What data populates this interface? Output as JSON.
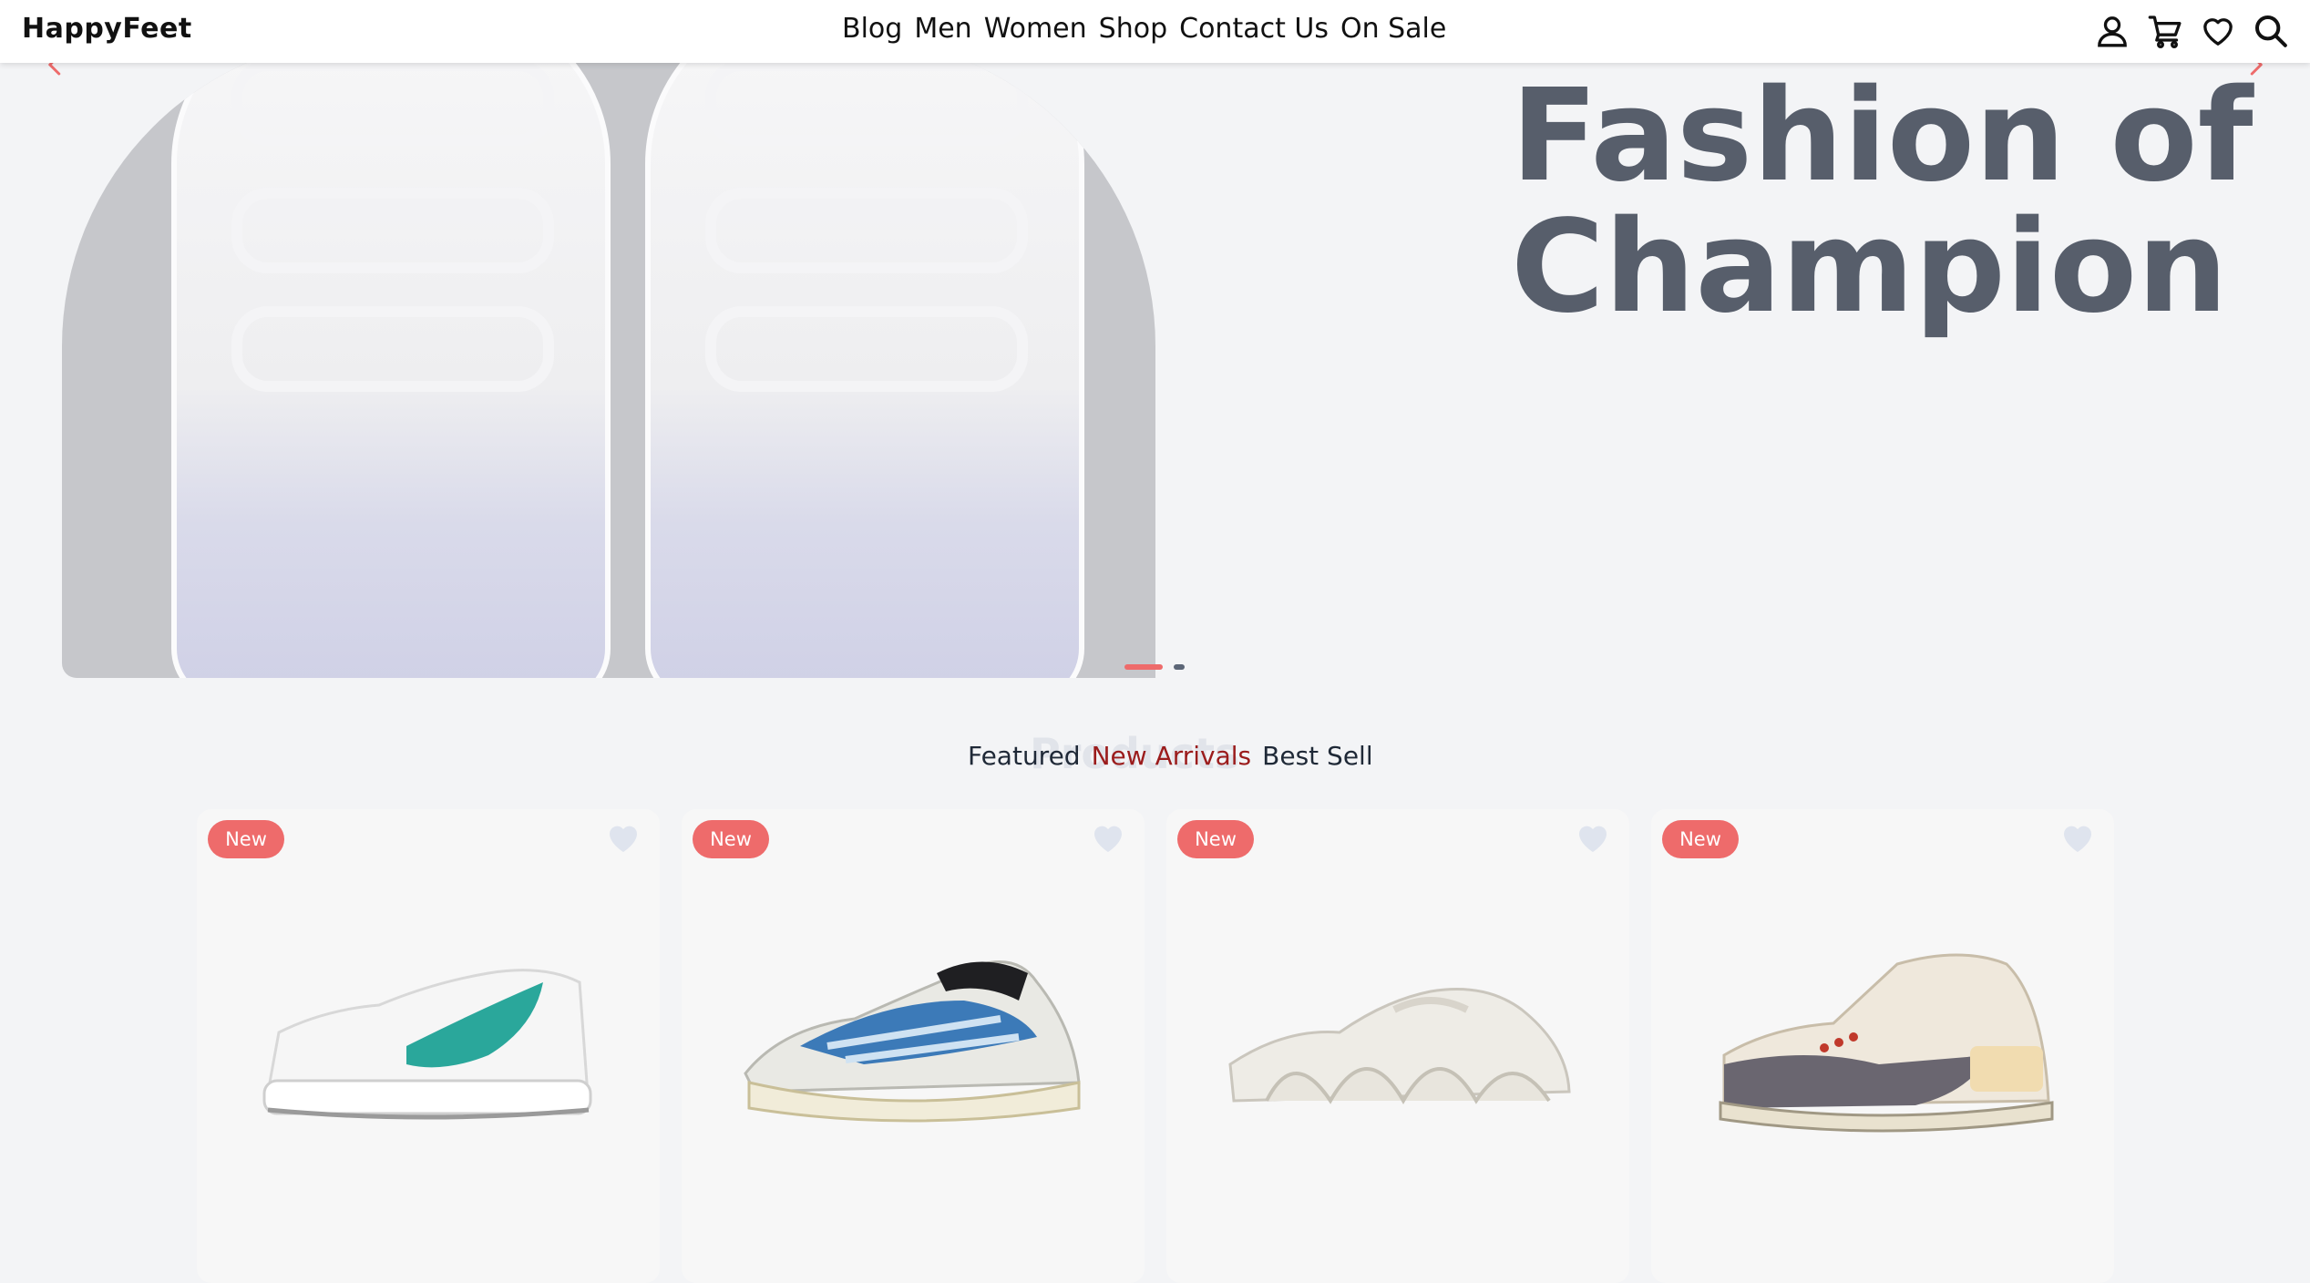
{
  "brand": "HappyFeet",
  "nav": {
    "links": [
      "Blog",
      "Men",
      "Women",
      "Shop",
      "Contact Us",
      "On Sale"
    ],
    "icons": [
      "user-icon",
      "cart-icon",
      "heart-icon",
      "search-icon"
    ]
  },
  "hero": {
    "headline_line1": "Fashion of",
    "headline_line2": "Champion",
    "slide_count": 2,
    "active_slide": 1
  },
  "products_section": {
    "heading": "Products",
    "tabs": [
      "Featured",
      "New Arrivals",
      "Best Sell"
    ],
    "active_tab": "New Arrivals"
  },
  "products": [
    {
      "badge": "New",
      "image": "white-teal-sneaker"
    },
    {
      "badge": "New",
      "image": "blue-runner-sneaker"
    },
    {
      "badge": "New",
      "image": "cream-wave-sneaker"
    },
    {
      "badge": "New",
      "image": "cream-grey-basketball-sneaker"
    }
  ],
  "colors": {
    "accent": "#ee6b6b",
    "active_tab": "#9b1c1c",
    "headline": "#575e6b",
    "page_bg": "#f3f4f6"
  }
}
